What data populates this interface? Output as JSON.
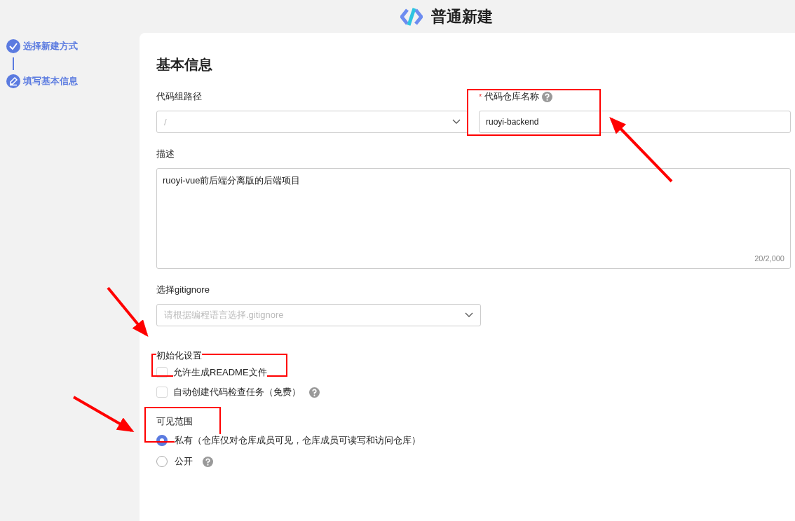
{
  "header": {
    "title": "普通新建"
  },
  "steps": [
    {
      "label": "选择新建方式",
      "kind": "check"
    },
    {
      "label": "填写基本信息",
      "kind": "edit"
    }
  ],
  "form": {
    "title": "基本信息",
    "group_path": {
      "label": "代码组路径",
      "placeholder": "/"
    },
    "repo_name": {
      "label": "代码仓库名称",
      "required_mark": "*",
      "value": "ruoyi-backend"
    },
    "description": {
      "label": "描述",
      "value": "ruoyi-vue前后端分离版的后端项目",
      "counter": "20/2,000"
    },
    "gitignore": {
      "label": "选择gitignore",
      "placeholder": "请根据编程语言选择.gitignore"
    },
    "init": {
      "label": "初始化设置",
      "options": [
        {
          "label": "允许生成README文件",
          "checked": false,
          "help": false
        },
        {
          "label": "自动创建代码检查任务（免费）",
          "checked": false,
          "help": true
        }
      ]
    },
    "visibility": {
      "label": "可见范围",
      "options": [
        {
          "label": "私有（仓库仅对仓库成员可见，仓库成员可读写和访问仓库）",
          "selected": true,
          "help": false
        },
        {
          "label": "公开",
          "selected": false,
          "help": true
        }
      ]
    }
  }
}
